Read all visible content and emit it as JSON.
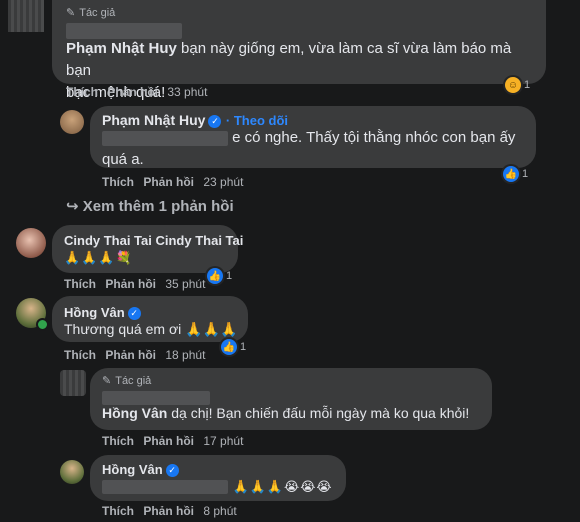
{
  "author_tag": "Tác giả",
  "actions": {
    "like": "Thích",
    "reply": "Phản hồi"
  },
  "c1": {
    "name": "Phạm Nhật Huy",
    "text_line1": "bạn này giống em, vừa làm ca sĩ vừa làm báo mà bạn",
    "text_line2": "bạc mệnh quá!",
    "time": "33 phút",
    "reaction_count": "1",
    "reaction_icon": "haha-icon"
  },
  "c2": {
    "name": "Phạm Nhật Huy",
    "follow": "· Theo dõi",
    "text_line1": "e có nghe. Thấy tội thằng nhóc con bạn ấy",
    "text_line2": "quá a.",
    "time": "23 phút",
    "reaction_count": "1"
  },
  "see_more": "Xem thêm 1 phản hồi",
  "c3": {
    "name": "Cindy Thai Tai Cindy Thai Tai",
    "text": "🙏🙏🙏💐",
    "time": "35 phút",
    "reaction_count": "1"
  },
  "c4": {
    "name": "Hồng Vân",
    "text": "Thương quá em ơi 🙏🙏🙏",
    "time": "18 phút",
    "reaction_count": "1"
  },
  "c5": {
    "mention": "Hồng Vân",
    "text": "dạ chị! Bạn chiến đấu mỗi ngày mà ko qua khỏi!",
    "time": "17 phút"
  },
  "c6": {
    "name": "Hồng Vân",
    "emojis": "🙏🙏🙏😭😭😭",
    "time": "8 phút"
  },
  "colors": {
    "background": "#18191a",
    "bubble": "#3a3b3c",
    "text": "#e4e6eb",
    "muted": "#b0b3b8",
    "link": "#2d88ff",
    "like": "#1877f2"
  }
}
